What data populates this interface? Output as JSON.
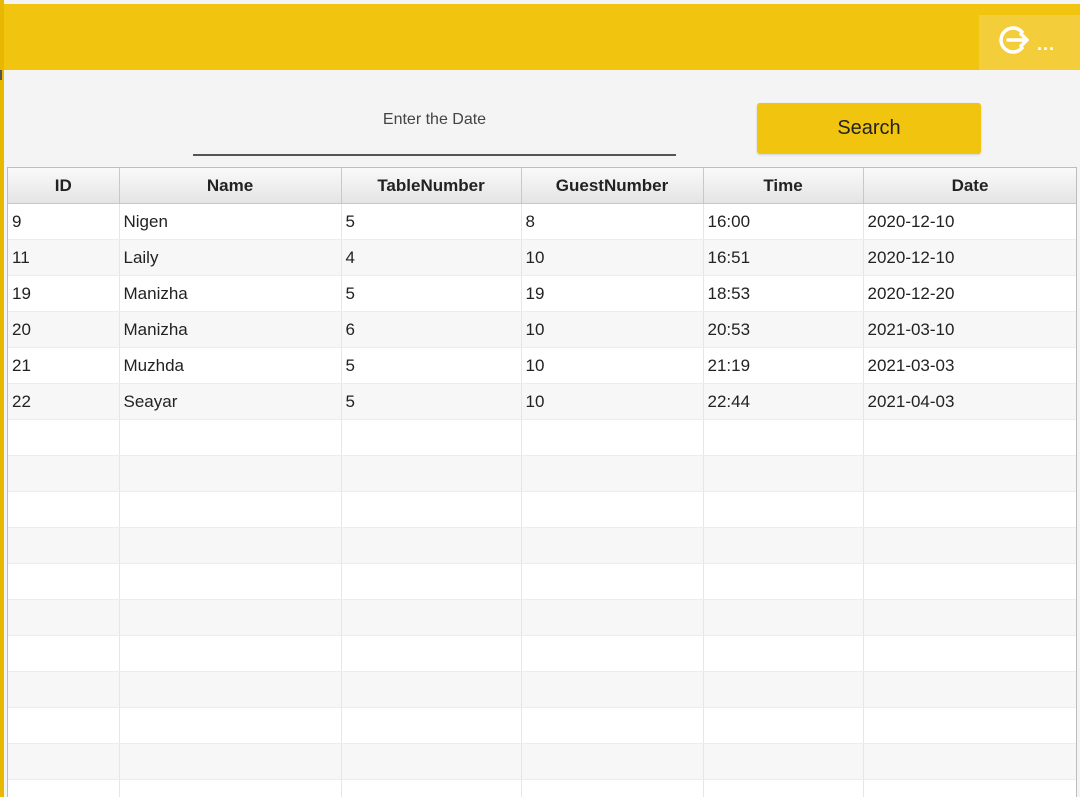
{
  "header": {
    "logout_dots": "...",
    "accent_color": "#f1c40f"
  },
  "search": {
    "placeholder": "Enter the Date",
    "value": "",
    "button_label": "Search"
  },
  "table": {
    "columns": [
      "ID",
      "Name",
      "TableNumber",
      "GuestNumber",
      "Time",
      "Date"
    ],
    "rows": [
      [
        "9",
        "Nigen",
        "5",
        "8",
        "16:00",
        "2020-12-10"
      ],
      [
        "11",
        "Laily",
        "4",
        "10",
        "16:51",
        "2020-12-10"
      ],
      [
        "19",
        "Manizha",
        "5",
        "19",
        "18:53",
        "2020-12-20"
      ],
      [
        "20",
        "Manizha",
        "6",
        "10",
        "20:53",
        "2021-03-10"
      ],
      [
        "21",
        "Muzhda",
        "5",
        "10",
        "21:19",
        "2021-03-03"
      ],
      [
        "22",
        "Seayar",
        "5",
        "10",
        "22:44",
        "2021-04-03"
      ]
    ]
  }
}
